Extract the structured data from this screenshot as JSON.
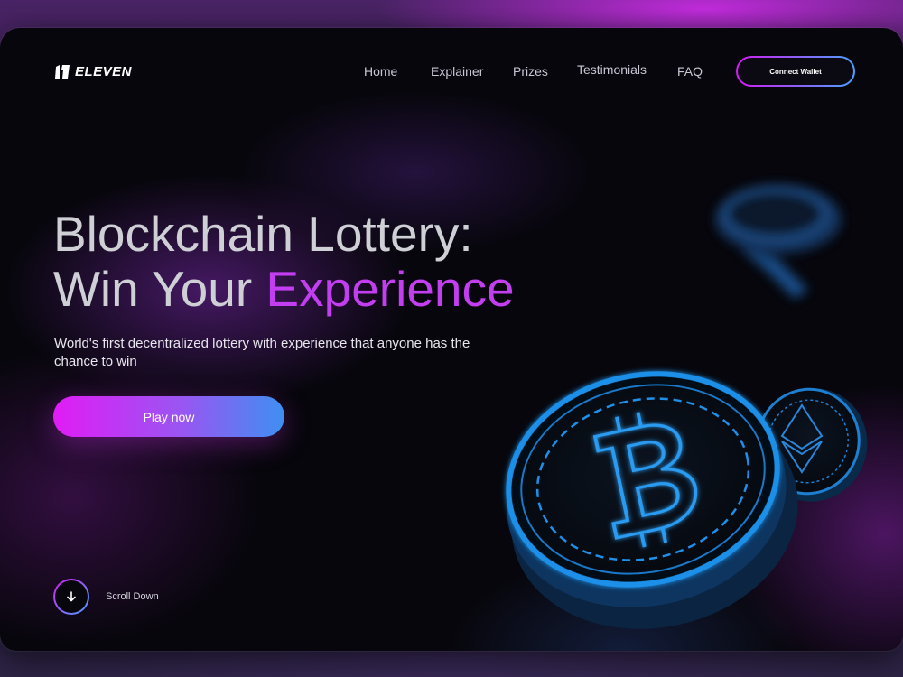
{
  "brand": {
    "name": "ELEVEN"
  },
  "nav": {
    "items": [
      {
        "label": "Home"
      },
      {
        "label": "Explainer"
      },
      {
        "label": "Prizes"
      },
      {
        "label": "Testimonials"
      },
      {
        "label": "FAQ"
      }
    ],
    "connect_label": "Connect Wallet"
  },
  "hero": {
    "title_line1": "Blockchain Lottery:",
    "title_line2_plain": "Win Your ",
    "title_line2_accent": "Experience",
    "subtitle": "World's first decentralized lottery with experience that anyone has the chance to win",
    "cta_label": "Play now"
  },
  "scroll": {
    "label": "Scroll Down"
  },
  "icons": {
    "logo": "eleven-logo-icon",
    "scroll": "arrow-down-icon",
    "coin_main": "bitcoin-coin-icon",
    "coin_side": "ethereum-coin-icon",
    "coin_blurred": "blurred-coin-icon"
  },
  "colors": {
    "accent": "#c23ef0",
    "gradient_start": "#e11cf5",
    "gradient_end": "#3f8ff2",
    "coin_blue": "#1e90e8"
  }
}
